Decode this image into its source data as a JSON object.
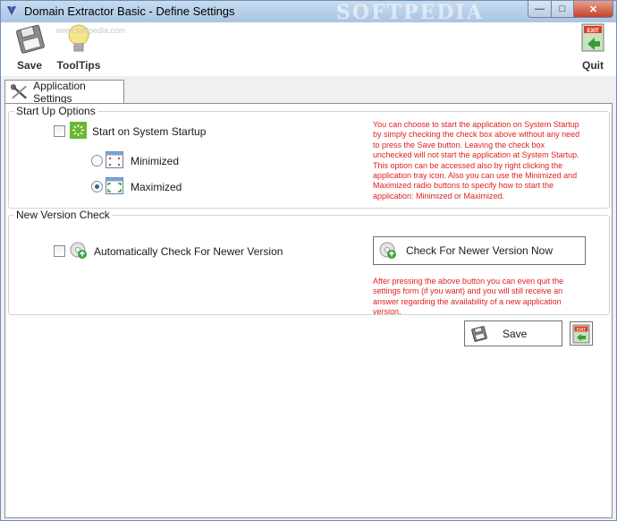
{
  "window": {
    "title": "Domain Extractor Basic - Define Settings",
    "watermark": "SOFTPEDIA",
    "minimize_glyph": "—",
    "maximize_glyph": "□",
    "close_glyph": "✕"
  },
  "toolbar": {
    "save_label": "Save",
    "tooltips_label": "ToolTips",
    "quit_label": "Quit",
    "exit_sign_text": "EXIT",
    "softpedia_mark": "www.softpedia.com"
  },
  "tabs": [
    {
      "label": "Application Settings",
      "selected": true
    }
  ],
  "startup": {
    "group_label": "Start Up Options",
    "checkbox_label": "Start on System Startup",
    "checked": false,
    "minimized_label": "Minimized",
    "maximized_label": "Maximized",
    "selected_mode": "Maximized",
    "info_lines": [
      "You can choose to start the application on System Startup",
      "by simply checking the check box above without any need",
      "to press the Save button. Leaving the check box",
      "unchecked will not start the application at System Startup.",
      "This option can be accessed also by right clicking the",
      "application tray icon. Also you can use the Minimized and",
      "Maximized radio buttons to specify how to start the",
      "application: Minimized or Maximized."
    ]
  },
  "version": {
    "group_label": "New Version Check",
    "checkbox_label": "Automatically Check For Newer Version",
    "checked": false,
    "check_button_label": "Check For Newer Version Now",
    "info_lines": [
      "After pressing the above button you can even quit the",
      "settings form (if you want) and you will still receive an",
      "answer regarding the availability of a new application",
      "version."
    ]
  },
  "footer": {
    "save_button_label": "Save",
    "exit_sign_text": "EXIT"
  },
  "colors": {
    "info_text": "#e02020",
    "titlebar": "#b9cfe8",
    "close_button": "#c6412b"
  }
}
